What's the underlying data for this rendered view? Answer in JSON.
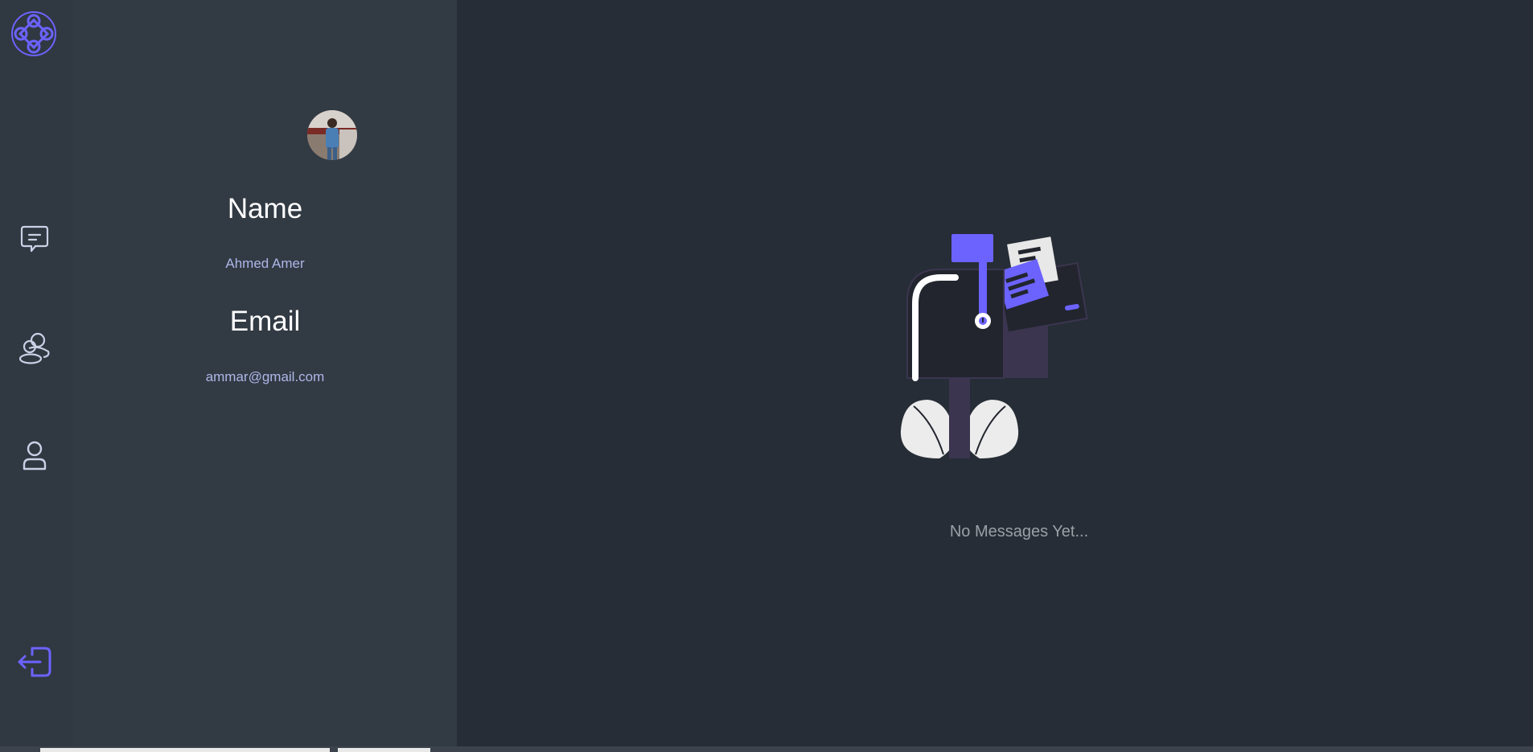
{
  "nav": {
    "logo_icon": "celtic-knot-logo-icon",
    "items": [
      {
        "id": "chats",
        "icon": "chat-bubble-icon"
      },
      {
        "id": "friends",
        "icon": "users-icon"
      },
      {
        "id": "profile",
        "icon": "user-icon"
      },
      {
        "id": "logout",
        "icon": "logout-icon"
      }
    ],
    "accent_color": "#6c63ff",
    "icon_color": "#c9d1e6"
  },
  "profile": {
    "name_label": "Name",
    "name_value": "Ahmed Amer",
    "email_label": "Email",
    "email_value": "ammar@gmail.com"
  },
  "chat": {
    "empty_message": "No Messages Yet...",
    "illustration": "mailbox-empty-illustration"
  }
}
